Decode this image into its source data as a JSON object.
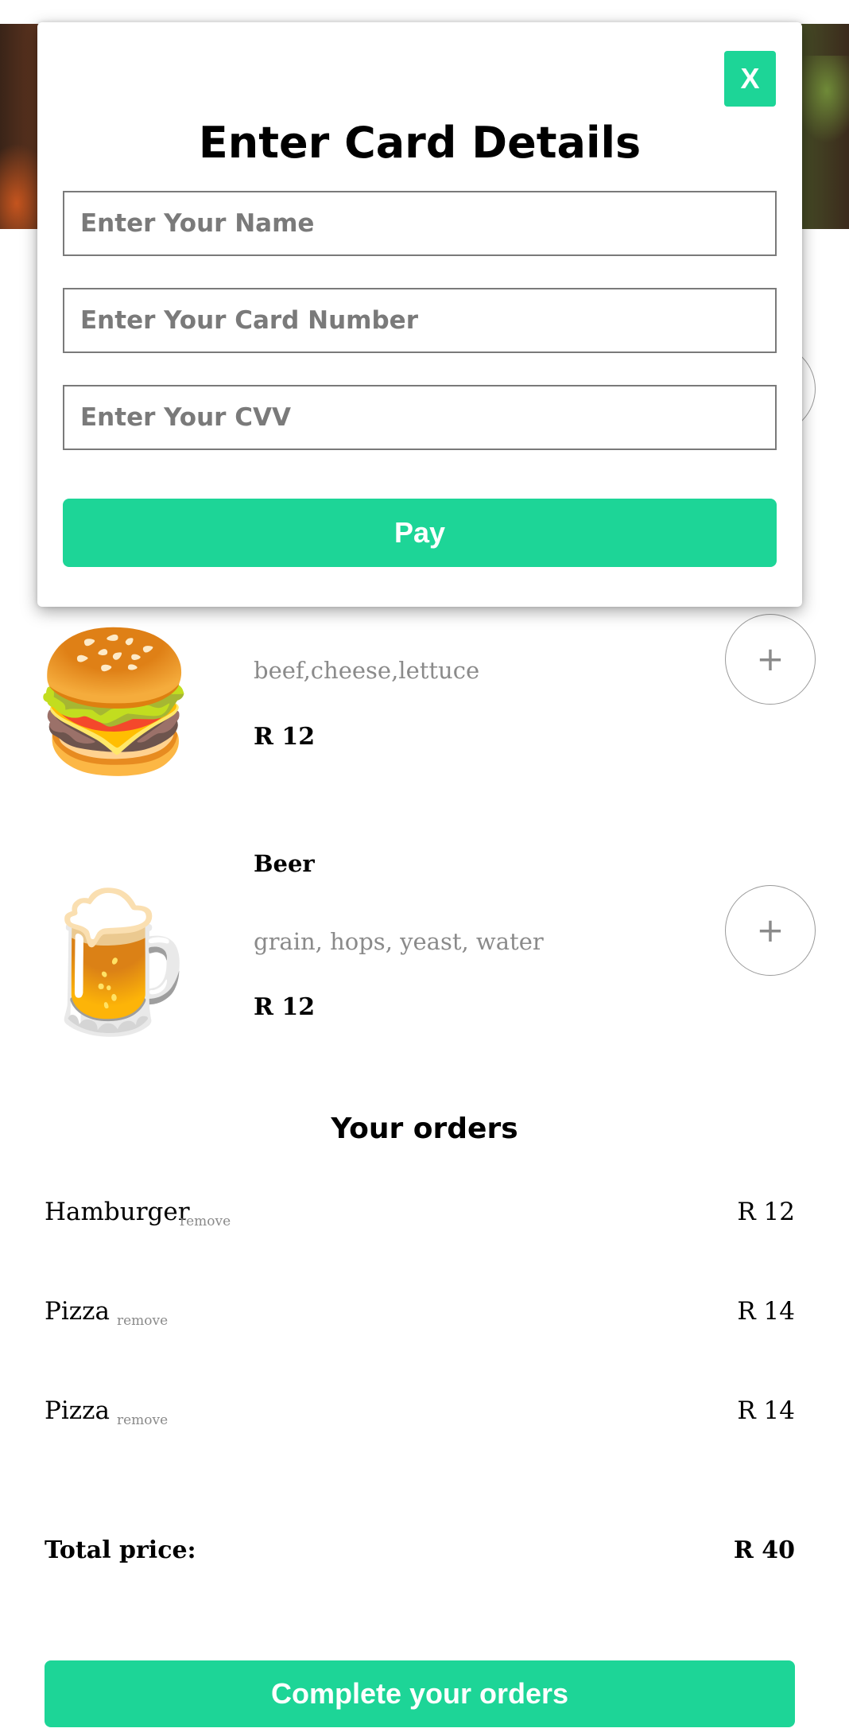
{
  "menu": {
    "partial_add_label": "+",
    "items": [
      {
        "name": "Hamburger",
        "emoji": "🍔",
        "description": "beef,cheese,lettuce",
        "price": "R 12",
        "add_label": "+"
      },
      {
        "name": "Beer",
        "emoji": "🍺",
        "description": "grain, hops, yeast, water",
        "price": "R 12",
        "add_label": "+"
      }
    ]
  },
  "orders": {
    "title": "Your orders",
    "remove_label": "remove",
    "rows": [
      {
        "name": "Hamburger",
        "price": "R 12"
      },
      {
        "name": "Pizza",
        "price": "R 14"
      },
      {
        "name": "Pizza",
        "price": "R 14"
      }
    ],
    "total_label": "Total price:",
    "total_value": "R 40",
    "complete_label": "Complete your orders"
  },
  "modal": {
    "close_label": "X",
    "title": "Enter Card Details",
    "name_placeholder": "Enter Your Name",
    "card_placeholder": "Enter Your Card Number",
    "cvv_placeholder": "Enter Your CVV",
    "pay_label": "Pay"
  },
  "colors": {
    "accent": "#1dd597"
  }
}
